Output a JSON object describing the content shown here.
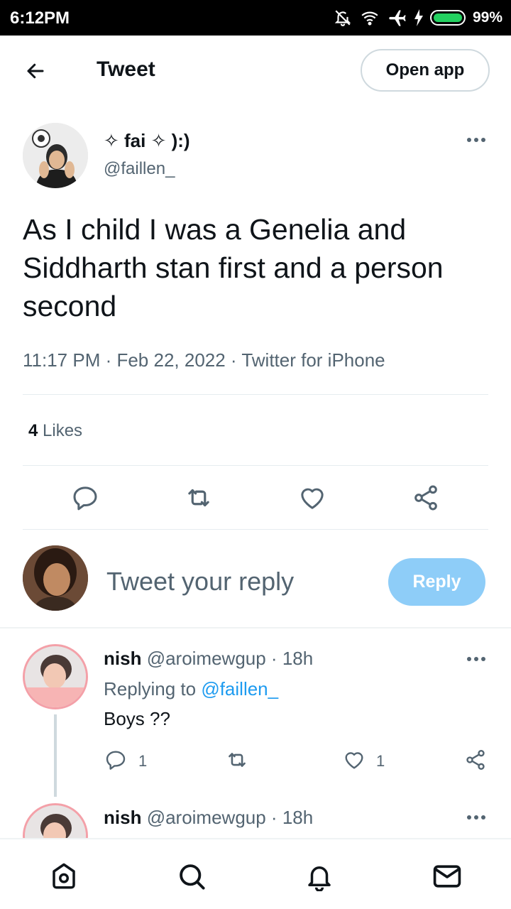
{
  "status": {
    "time": "6:12PM",
    "battery": "99%",
    "battery_level": 0.99
  },
  "header": {
    "back_icon": "arrow-left-icon",
    "title": "Tweet",
    "open_app": "Open app"
  },
  "tweet": {
    "author_name": "✧ fai ✧ ):)",
    "author_handle": "@faillen_",
    "text": "As I child I was a Genelia and Siddharth stan first and a person second",
    "meta": "11:17 PM · Feb 22, 2022 · Twitter for iPhone",
    "likes_count": "4",
    "likes_label": "Likes"
  },
  "composer": {
    "placeholder": "Tweet your reply",
    "reply_label": "Reply"
  },
  "replies": [
    {
      "name": "nish",
      "handle_time": "@aroimewgup · 18h",
      "replying_prefix": "Replying to",
      "mention": "@faillen_",
      "text": "Boys ??",
      "reply_count": "1",
      "like_count": "1"
    },
    {
      "name": "nish",
      "handle_time": "@aroimewgup · 18h"
    }
  ],
  "colors": {
    "accent": "#1d9bf0",
    "reply_button": "#8ecdf8",
    "secondary_text": "#536471"
  }
}
